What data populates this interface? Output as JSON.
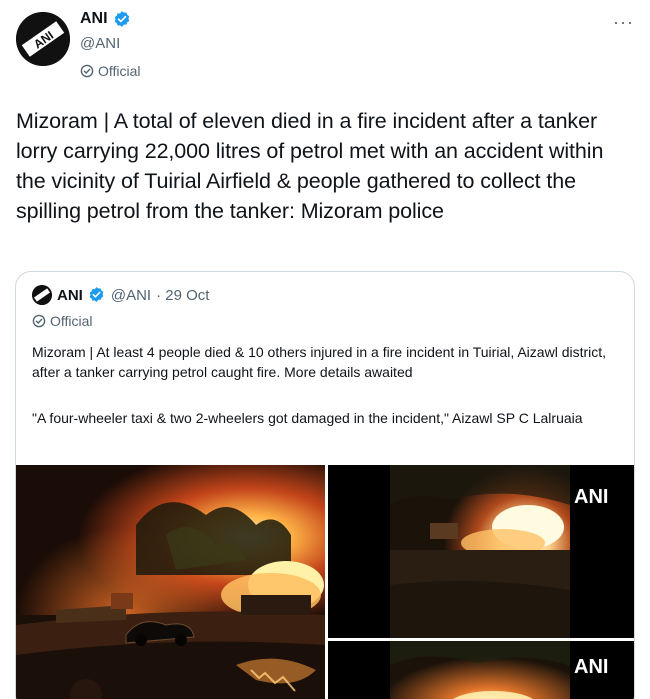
{
  "tweet": {
    "author_name": "ANI",
    "author_handle": "@ANI",
    "official_label": "Official",
    "more_label": "···",
    "text": "Mizoram | A total of eleven died in a fire incident after a tanker lorry carrying 22,000 litres of petrol met with an accident within the vicinity of Tuirial Airfield & people gathered to collect the spilling petrol from the tanker: Mizoram police",
    "logo_text": "ANI"
  },
  "quoted_tweet": {
    "author_name": "ANI",
    "author_handle": "@ANI",
    "date": "· 29 Oct",
    "official_label": "Official",
    "text_1": "Mizoram | At least 4 people died & 10 others injured in a fire incident in Tuirial, Aizawl district, after a tanker carrying petrol caught fire. More details awaited",
    "text_2": "\"A four-wheeler taxi & two 2-wheelers got damaged in the incident,\" Aizawl SP C Lalruaia",
    "media_watermark": "ANI"
  },
  "colors": {
    "verified_blue": "#1d9bf0",
    "secondary_text": "#536471",
    "primary_text": "#0f1419",
    "border": "#cfd9de"
  }
}
